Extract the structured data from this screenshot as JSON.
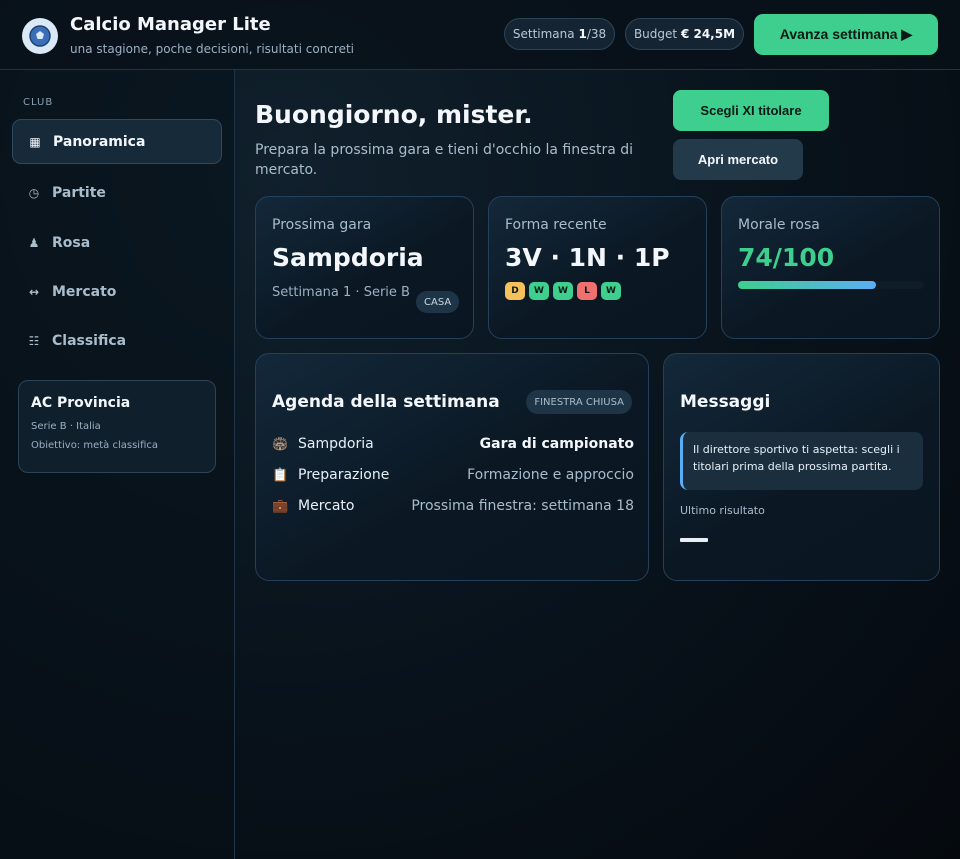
{
  "header": {
    "title": "Calcio Manager Lite",
    "subtitle": "una stagione, poche decisioni, risultati concreti",
    "week_label": "Settimana",
    "week_current": "1",
    "week_total": "/38",
    "budget_label": "Budget",
    "budget_value": "€ 24,5M",
    "advance_label": "Avanza settimana ▶"
  },
  "sidebar": {
    "section_label": "CLUB",
    "items": [
      {
        "label": "Panoramica",
        "icon": "grid-icon",
        "active": true
      },
      {
        "label": "Partite",
        "icon": "clock-icon"
      },
      {
        "label": "Rosa",
        "icon": "person-icon"
      },
      {
        "label": "Mercato",
        "icon": "transfer-arrows-icon"
      },
      {
        "label": "Classifica",
        "icon": "list-icon"
      }
    ],
    "club": {
      "name": "AC Provincia",
      "league": "Serie B · Italia",
      "objective": "Obiettivo: metà classifica"
    }
  },
  "main": {
    "greeting": "Buongiorno, mister.",
    "greeting_sub": "Prepara la prossima gara e tieni d'occhio la finestra di mercato.",
    "btn_xi": "Scegli XI titolare",
    "btn_market": "Apri mercato",
    "next_match": {
      "label": "Prossima gara",
      "opponent": "Sampdoria",
      "meta": "Settimana 1 · Serie B",
      "venue": "CASA"
    },
    "form": {
      "label": "Forma recente",
      "summary": "3V · 1N · 1P",
      "results": [
        "D",
        "W",
        "W",
        "L",
        "W"
      ]
    },
    "morale": {
      "label": "Morale rosa",
      "value": "74/100",
      "level": 0.74
    },
    "agenda": {
      "title": "Agenda della settimana",
      "badge": "FINESTRA CHIUSA",
      "rows": [
        {
          "icon": "stadium-icon",
          "label": "Sampdoria",
          "value": "Gara di campionato"
        },
        {
          "icon": "clipboard-icon",
          "label": "Preparazione",
          "value": "Formazione e approccio"
        },
        {
          "icon": "briefcase-icon",
          "label": "Mercato",
          "value": "Prossima finestra: settimana 18"
        }
      ]
    },
    "messages": {
      "title": "Messaggi",
      "text": "Il direttore sportivo ti aspetta: scegli i titolari prima della prossima partita.",
      "last_result_label": "Ultimo risultato",
      "last_result_value": "—"
    }
  },
  "colors": {
    "accent": "#3ecf8e",
    "info": "#5aaef5",
    "draw": "#f5c15a",
    "win": "#3ecf8e",
    "loss": "#f07070"
  }
}
